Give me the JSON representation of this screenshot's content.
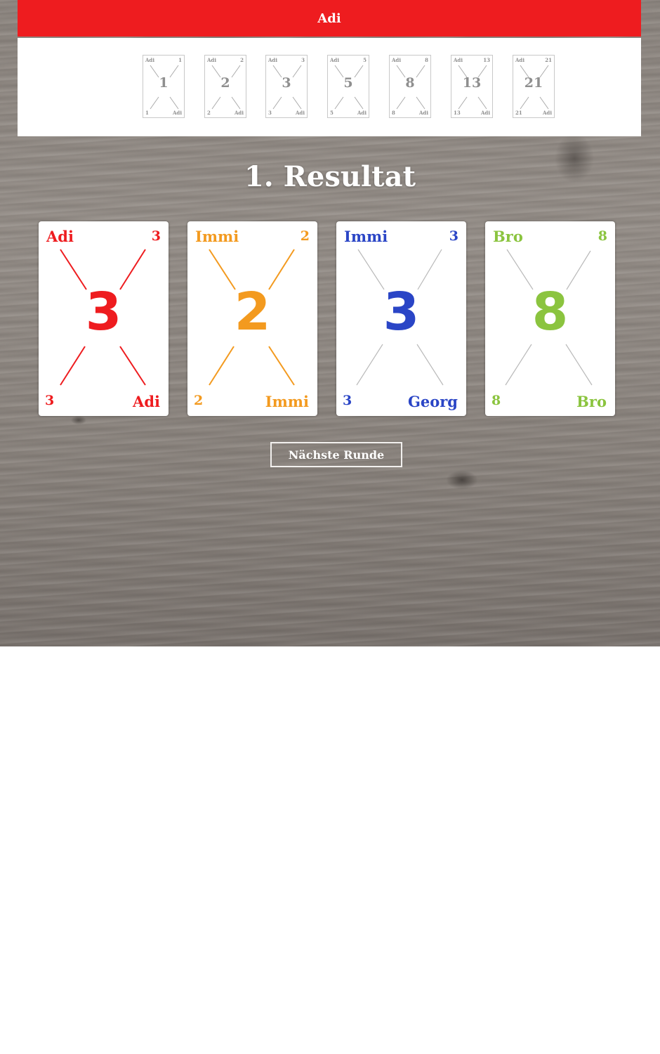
{
  "header": {
    "player_name": "Adi",
    "accent_color": "#ee1c1f"
  },
  "hand": {
    "owner": "Adi",
    "cards": [
      {
        "value": "1"
      },
      {
        "value": "2"
      },
      {
        "value": "3"
      },
      {
        "value": "5"
      },
      {
        "value": "8"
      },
      {
        "value": "13"
      },
      {
        "value": "21"
      }
    ]
  },
  "result": {
    "title": "1. Resultat",
    "cards": [
      {
        "top_name": "Adi",
        "bottom_name": "Adi",
        "value": "3",
        "color": "#ee1c1f"
      },
      {
        "top_name": "Immi",
        "bottom_name": "Immi",
        "value": "2",
        "color": "#f39a1f"
      },
      {
        "top_name": "Immi",
        "bottom_name": "Georg",
        "value": "3",
        "color": "#2a45c6",
        "line_color": "#b9b9b9"
      },
      {
        "top_name": "Bro",
        "bottom_name": "Bro",
        "value": "8",
        "color": "#8bc43f",
        "line_color": "#b9b9b9"
      }
    ]
  },
  "actions": {
    "next_round_label": "Nächste Runde"
  }
}
